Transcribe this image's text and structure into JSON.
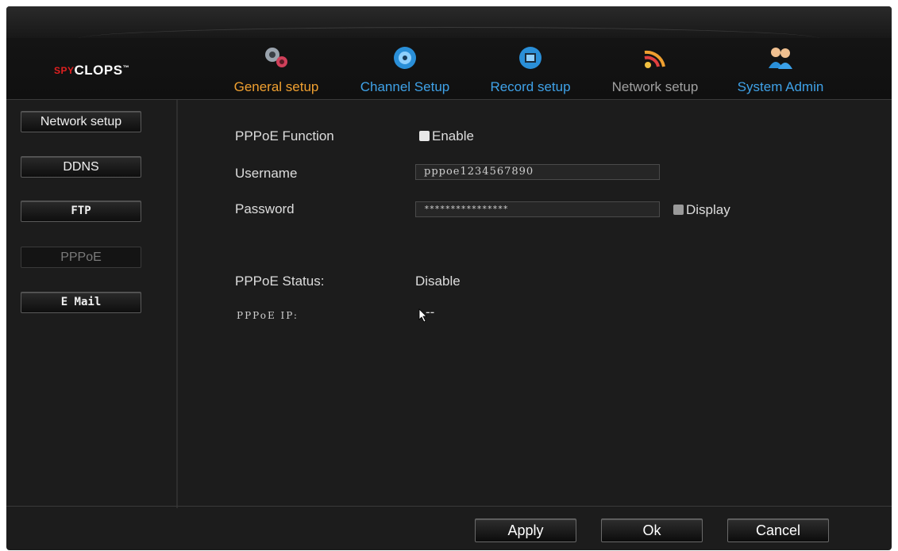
{
  "brand": {
    "logo_prefix": "SPY",
    "logo_main": "CLOPS",
    "logo_tm": "™"
  },
  "nav": [
    {
      "label": "General setup",
      "icon": "gears-icon",
      "color": "#f0a030",
      "active": true
    },
    {
      "label": "Channel Setup",
      "icon": "camera-icon",
      "color": "#3fa2e8",
      "active": false
    },
    {
      "label": "Record setup",
      "icon": "record-icon",
      "color": "#3fa2e8",
      "active": false
    },
    {
      "label": "Network setup",
      "icon": "wifi-icon",
      "color": "#a0a0a0",
      "active": false
    },
    {
      "label": "System Admin",
      "icon": "users-icon",
      "color": "#3fa2e8",
      "active": false
    }
  ],
  "sidebar": {
    "items": [
      {
        "label": "Network setup"
      },
      {
        "label": "DDNS"
      },
      {
        "label": "FTP"
      },
      {
        "label": "PPPoE",
        "active": true
      },
      {
        "label": "E Mail"
      }
    ]
  },
  "form": {
    "pppoe_function_label": "PPPoE Function",
    "enable_label": "Enable",
    "username_label": "Username",
    "username_value": "pppoe1234567890",
    "password_label": "Password",
    "password_value": "****************",
    "display_label": "Display",
    "status_label": "PPPoE Status:",
    "status_value": "Disable",
    "ip_label": "PPPoE IP:",
    "ip_value": "--"
  },
  "footer": {
    "apply_label": "Apply",
    "ok_label": "Ok",
    "cancel_label": "Cancel"
  }
}
